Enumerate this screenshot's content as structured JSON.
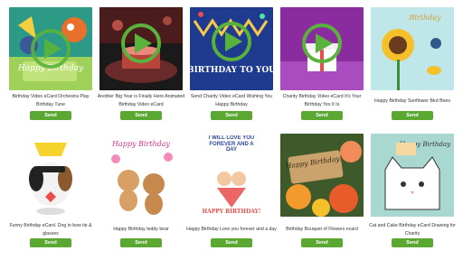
{
  "colors": {
    "send_button": "#5aa832",
    "play_icon": "#59b33b"
  },
  "cards": [
    {
      "title": "Birthday Video eCard Orchestra Play Birthday Tune",
      "send_label": "Send",
      "has_play": true,
      "art_text": "Happy Birthday"
    },
    {
      "title": "Another Big Year is Finally Here Animated Birthday Video eCard",
      "send_label": "Send",
      "has_play": true,
      "art_text": ""
    },
    {
      "title": "Send Charity Video eCard Wishing You Happy Birthday",
      "send_label": "Send",
      "has_play": true,
      "art_text": "BIRTHDAY TO YOU"
    },
    {
      "title": "Charity Birthday Video eCard It's Your Birthday Yes It Is",
      "send_label": "Send",
      "has_play": true,
      "art_text": ""
    },
    {
      "title": "Happy Birthday Sunflower Bird Bees",
      "send_label": "Send",
      "has_play": false,
      "art_text": "Birthday"
    },
    {
      "title": "Funny Birthday eCard. Dog in bow tie & glasses",
      "send_label": "Send",
      "has_play": false,
      "art_text": ""
    },
    {
      "title": "Happy Birthday teddy bear",
      "send_label": "Send",
      "has_play": false,
      "art_text": "Happy Birthday"
    },
    {
      "title": "Happy Birthday Love you forever and a day",
      "send_label": "Send",
      "has_play": false,
      "art_text": "I WILL LOVE YOU FOREVER AND A DAY",
      "art_text_2": "HAPPY BIRTHDAY!"
    },
    {
      "title": "Birthday Bouquet of Flowers ecard",
      "send_label": "Send",
      "has_play": false,
      "art_text": "Happy Birthday!"
    },
    {
      "title": "Cat and Cake Birthday eCard Drawing for Charity",
      "send_label": "Send",
      "has_play": false,
      "art_text": "Happy Birthday"
    }
  ]
}
